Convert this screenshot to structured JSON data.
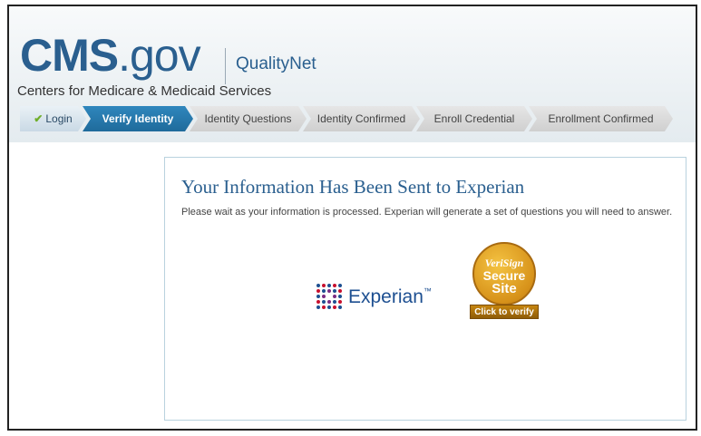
{
  "header": {
    "logo_cms": "CMS",
    "logo_gov": ".gov",
    "product": "QualityNet",
    "tagline": "Centers for Medicare & Medicaid Services"
  },
  "steps": [
    {
      "label": "Login",
      "state": "complete"
    },
    {
      "label": "Verify Identity",
      "state": "active"
    },
    {
      "label": "Identity Questions",
      "state": "pending"
    },
    {
      "label": "Identity Confirmed",
      "state": "pending"
    },
    {
      "label": "Enroll Credential",
      "state": "pending"
    },
    {
      "label": "Enrollment Confirmed",
      "state": "pending"
    }
  ],
  "main": {
    "title": "Your Information Has Been Sent to Experian",
    "message": "Please wait as your information is processed. Experian will generate a set of questions you will need to answer."
  },
  "experian": {
    "name": "Experian",
    "tm": "™"
  },
  "verisign": {
    "brand": "VeriSign",
    "line1": "Secure",
    "line2": "Site",
    "click": "Click to verify"
  },
  "colors": {
    "brand_blue": "#2a5f8f",
    "active_step": "#1f6b9b",
    "complete_check": "#6fae2a",
    "experian_blue": "#1d4f91",
    "seal_gold": "#d7921a"
  }
}
